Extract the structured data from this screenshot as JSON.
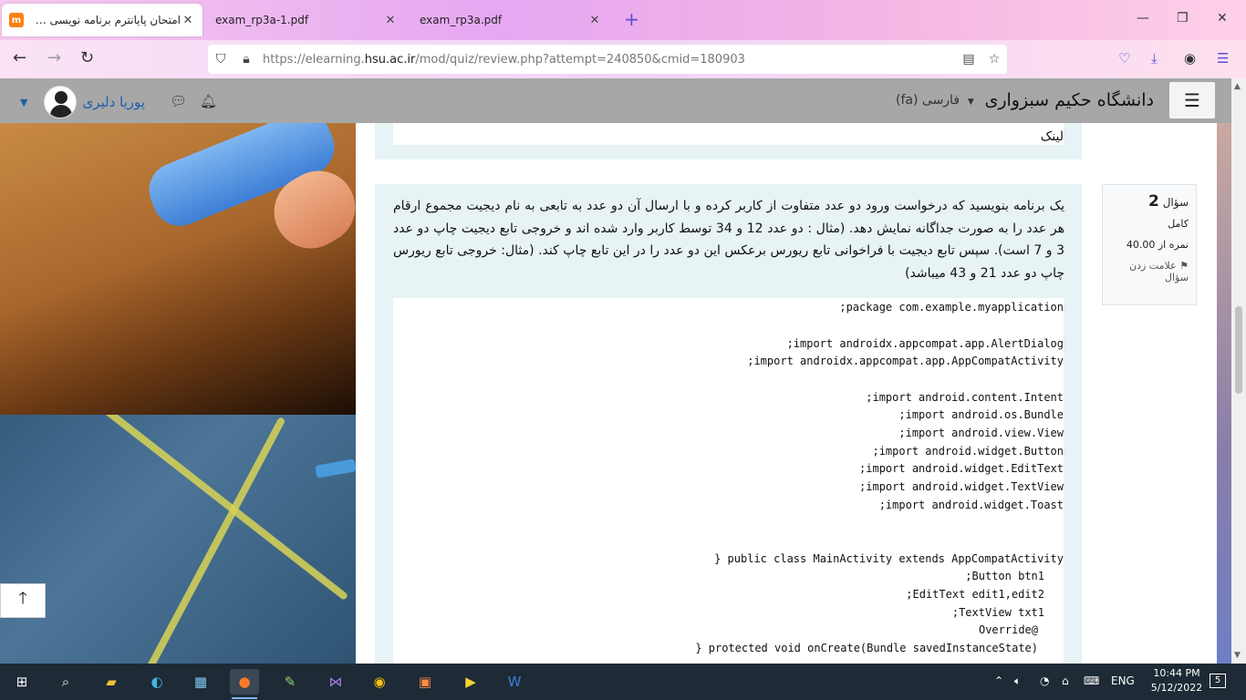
{
  "browser": {
    "tabs": [
      {
        "title": "امتحان پایانترم برنامه نویسی سیار",
        "favicon": "m"
      },
      {
        "title": "exam_rp3a-1.pdf"
      },
      {
        "title": "exam_rp3a.pdf"
      }
    ],
    "url_prefix": "https://elearning.",
    "url_domain": "hsu.ac.ir",
    "url_rest": "/mod/quiz/review.php?attempt=240850&cmid=180903"
  },
  "header": {
    "site_name": "دانشگاه حکیم سبزواری",
    "language": "فارسی (fa)",
    "user_name": "پوریا دلیری"
  },
  "prev_question": {
    "link_label": "لینک"
  },
  "question": {
    "number_label": "سؤال",
    "number": "2",
    "state": "کامل",
    "grade": "نمره از 40.00",
    "flag_label": "علامت زدن سؤال",
    "text": "یک برنامه بنویسید که درخواست ورود دو عدد متفاوت از کاربر کرده و با ارسال آن دو عدد به تابعی به نام دیجیت مجموع ارقام هر عدد را به صورت جداگانه نمایش دهد. (مثال : دو عدد 12 و 34 توسط کاربر وارد شده اند و خروجی تابع دیجیت چاپ دو عدد 3 و 7 است). سپس تابع دیجیت با فراخوانی تابع ریورس برعکس این دو عدد را در این تابع چاپ کند. (مثال: خروجی تابع ریورس چاپ دو عدد 21 و 43 میباشد)"
  },
  "code_lines": [
    ";package com.example.myapplication",
    ";import androidx.appcompat.app.AlertDialog",
    ";import androidx.appcompat.app.AppCompatActivity",
    ";import android.content.Intent",
    ";import android.os.Bundle",
    ";import android.view.View",
    ";import android.widget.Button",
    ";import android.widget.EditText",
    ";import android.widget.TextView",
    ";import android.widget.Toast",
    "} public class MainActivity extends AppCompatActivity",
    ";Button btn1",
    ";EditText edit1,edit2",
    ";TextView txt1",
    "Override@",
    "} protected void onCreate(Bundle savedInstanceState)"
  ],
  "taskbar": {
    "language": "ENG",
    "time": "10:44 PM",
    "date": "5/12/2022",
    "notifications": "5"
  }
}
